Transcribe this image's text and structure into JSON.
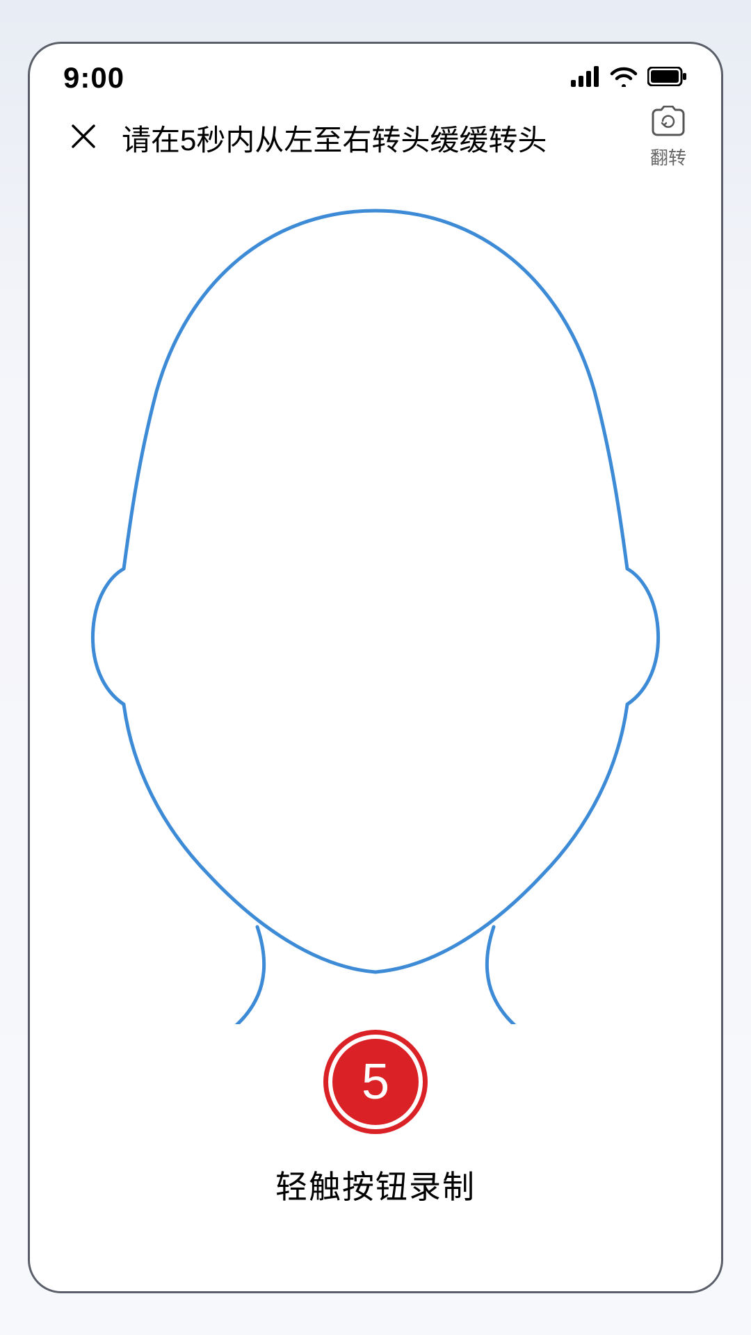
{
  "status": {
    "time": "9:00"
  },
  "header": {
    "title": "请在5秒内从左至右转头缓缓转头",
    "flip_label": "翻转"
  },
  "record": {
    "countdown": "5",
    "hint": "轻触按钮录制"
  },
  "colors": {
    "face_outline": "#3d8bd6",
    "record_red": "#da2126"
  }
}
